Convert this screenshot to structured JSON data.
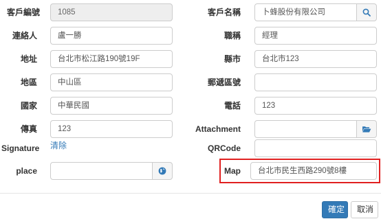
{
  "form": {
    "customer_no": {
      "label": "客戶編號",
      "value": "1085"
    },
    "customer_name": {
      "label": "客戶名稱",
      "value": "卜蜂股份有限公司"
    },
    "contact": {
      "label": "連絡人",
      "value": "盧一勝"
    },
    "title": {
      "label": "職稱",
      "value": "經理"
    },
    "address": {
      "label": "地址",
      "value": "台北市松江路190號19F"
    },
    "city": {
      "label": "縣市",
      "value": "台北市123"
    },
    "district": {
      "label": "地區",
      "value": "中山區"
    },
    "zip": {
      "label": "郵遞區號",
      "value": ""
    },
    "country": {
      "label": "國家",
      "value": "中華民國"
    },
    "phone": {
      "label": "電話",
      "value": "123"
    },
    "fax": {
      "label": "傳真",
      "value": "123"
    },
    "attachment": {
      "label": "Attachment",
      "value": ""
    },
    "signature": {
      "label": "Signature",
      "clear_link": "清除"
    },
    "qrcode": {
      "label": "QRCode",
      "value": ""
    },
    "place": {
      "label": "place",
      "value": ""
    },
    "map": {
      "label": "Map",
      "value": "台北市民生西路290號8樓"
    }
  },
  "footer": {
    "confirm_label": "確定",
    "cancel_label": "取消"
  },
  "colors": {
    "primary": "#337ab7",
    "highlight": "#e02020"
  }
}
